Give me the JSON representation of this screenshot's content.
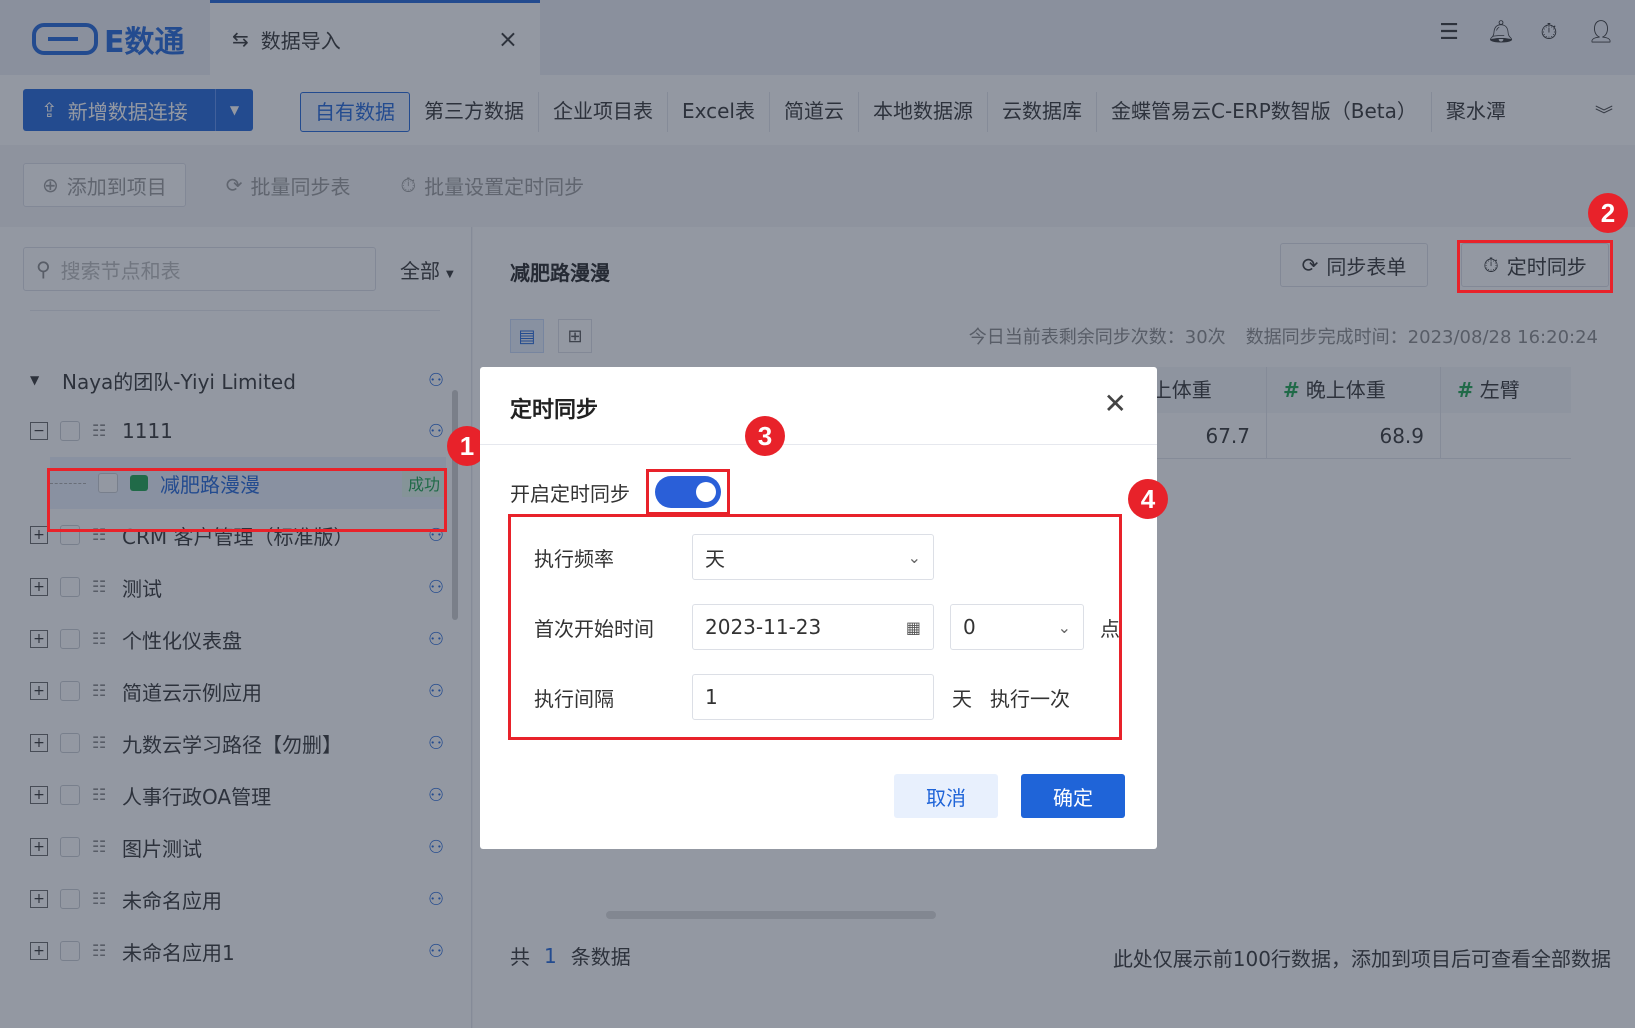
{
  "app": {
    "brand": "E数通",
    "tab_title": "数据导入",
    "tab_close": "×"
  },
  "topbar_icons": [
    "checklist-icon",
    "bell-icon",
    "timer-icon",
    "user-icon"
  ],
  "sourcebar": {
    "new_connection": "新增数据连接",
    "tabs": [
      "自有数据",
      "第三方数据",
      "企业项目表",
      "Excel表",
      "简道云",
      "本地数据源",
      "云数据库",
      "金蝶管易云C-ERP数智版（Beta）",
      "聚水潭"
    ],
    "active_tab": "自有数据"
  },
  "actions": {
    "add_to_project": "添加到项目",
    "batch_sync": "批量同步表",
    "batch_timed": "批量设置定时同步"
  },
  "left": {
    "search_placeholder": "搜索节点和表",
    "filter": "全部",
    "team": "Naya的团队-Yiyi Limited",
    "tree": [
      {
        "label": "1111",
        "expanded": true
      },
      {
        "label": "减肥路漫漫",
        "status": "成功",
        "child": true
      },
      {
        "label": "CRM 客户管理（标准版）"
      },
      {
        "label": "测试"
      },
      {
        "label": "个性化仪表盘"
      },
      {
        "label": "简道云示例应用"
      },
      {
        "label": "九数云学习路径【勿删】"
      },
      {
        "label": "人事行政OA管理"
      },
      {
        "label": "图片测试"
      },
      {
        "label": "未命名应用"
      },
      {
        "label": "未命名应用1"
      }
    ]
  },
  "right": {
    "table_name": "减肥路漫漫",
    "sync_table": "同步表单",
    "timed_sync": "定时同步",
    "remaining": "今日当前表剩余同步次数：30次",
    "finish_time": "数据同步完成时间：2023/08/28 16:20:24",
    "columns": [
      {
        "hash": "#",
        "name": "早上体重"
      },
      {
        "hash": "#",
        "name": "晚上体重"
      },
      {
        "hash": "#",
        "name": "左臂"
      }
    ],
    "row": [
      "67.7",
      "68.9",
      ""
    ],
    "footer_prefix": "共",
    "footer_count": "1",
    "footer_suffix": "条数据",
    "footer_note": "此处仅展示前100行数据，添加到项目后可查看全部数据"
  },
  "dialog": {
    "title": "定时同步",
    "toggle_label": "开启定时同步",
    "toggle_on": true,
    "frequency_label": "执行频率",
    "frequency_value": "天",
    "start_label": "首次开始时间",
    "start_date": "2023-11-23",
    "start_hour": "0",
    "hour_unit": "点",
    "interval_label": "执行间隔",
    "interval_value": "1",
    "interval_unit": "天",
    "interval_suffix": "执行一次",
    "cancel": "取消",
    "ok": "确定"
  },
  "annotations": [
    "1",
    "2",
    "3",
    "4"
  ],
  "colors": {
    "primary": "#1f64d8",
    "annotation": "#e8222a",
    "success": "#19a34a"
  }
}
